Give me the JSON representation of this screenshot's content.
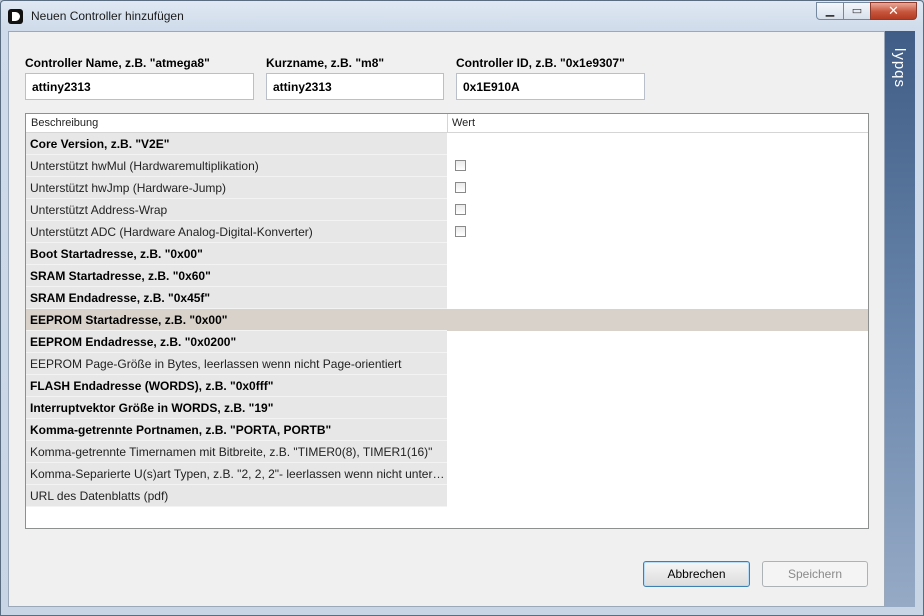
{
  "window": {
    "title": "Neuen Controller hinzufügen",
    "side_label": "lypqs",
    "minimize_glyph": "▁",
    "maximize_glyph": "▭",
    "close_glyph": "✕"
  },
  "fields": {
    "name": {
      "label": "Controller Name, z.B. \"atmega8\"",
      "value": "attiny2313"
    },
    "short": {
      "label": "Kurzname, z.B. \"m8\"",
      "value": "attiny2313"
    },
    "id": {
      "label": "Controller ID, z.B. \"0x1e9307\"",
      "value": "0x1E910A"
    }
  },
  "grid": {
    "col_description": "Beschreibung",
    "col_value": "Wert",
    "rows": [
      {
        "label": "Core Version, z.B. \"V2E\"",
        "bold": true,
        "checkbox": false
      },
      {
        "label": "Unterstützt hwMul (Hardwaremultiplikation)",
        "bold": false,
        "checkbox": true
      },
      {
        "label": "Unterstützt hwJmp (Hardware-Jump)",
        "bold": false,
        "checkbox": true
      },
      {
        "label": "Unterstützt Address-Wrap",
        "bold": false,
        "checkbox": true
      },
      {
        "label": "Unterstützt ADC (Hardware Analog-Digital-Konverter)",
        "bold": false,
        "checkbox": true
      },
      {
        "label": "Boot Startadresse, z.B. \"0x00\"",
        "bold": true,
        "checkbox": false
      },
      {
        "label": "SRAM Startadresse, z.B. \"0x60\"",
        "bold": true,
        "checkbox": false
      },
      {
        "label": "SRAM Endadresse, z.B. \"0x45f\"",
        "bold": true,
        "checkbox": false
      },
      {
        "label": "EEPROM Startadresse, z.B. \"0x00\"",
        "bold": true,
        "checkbox": false,
        "selected": true
      },
      {
        "label": "EEPROM Endadresse, z.B. \"0x0200\"",
        "bold": true,
        "checkbox": false
      },
      {
        "label": "EEPROM Page-Größe in Bytes, leerlassen wenn nicht Page-orientiert",
        "bold": false,
        "checkbox": false
      },
      {
        "label": "FLASH Endadresse (WORDS), z.B. \"0x0fff\"",
        "bold": true,
        "checkbox": false
      },
      {
        "label": "Interruptvektor Größe in WORDS, z.B. \"19\"",
        "bold": true,
        "checkbox": false
      },
      {
        "label": "Komma-getrennte Portnamen, z.B. \"PORTA, PORTB\"",
        "bold": true,
        "checkbox": false
      },
      {
        "label": "Komma-getrennte Timernamen mit Bitbreite, z.B. \"TIMER0(8), TIMER1(16)\"",
        "bold": false,
        "checkbox": false
      },
      {
        "label": "Komma-Separierte U(s)art Typen, z.B. \"2, 2, 2\"- leerlassen wenn nicht unterstü...",
        "bold": false,
        "checkbox": false
      },
      {
        "label": "URL des Datenblatts (pdf)",
        "bold": false,
        "checkbox": false
      }
    ]
  },
  "buttons": {
    "cancel": "Abbrechen",
    "save": "Speichern"
  }
}
